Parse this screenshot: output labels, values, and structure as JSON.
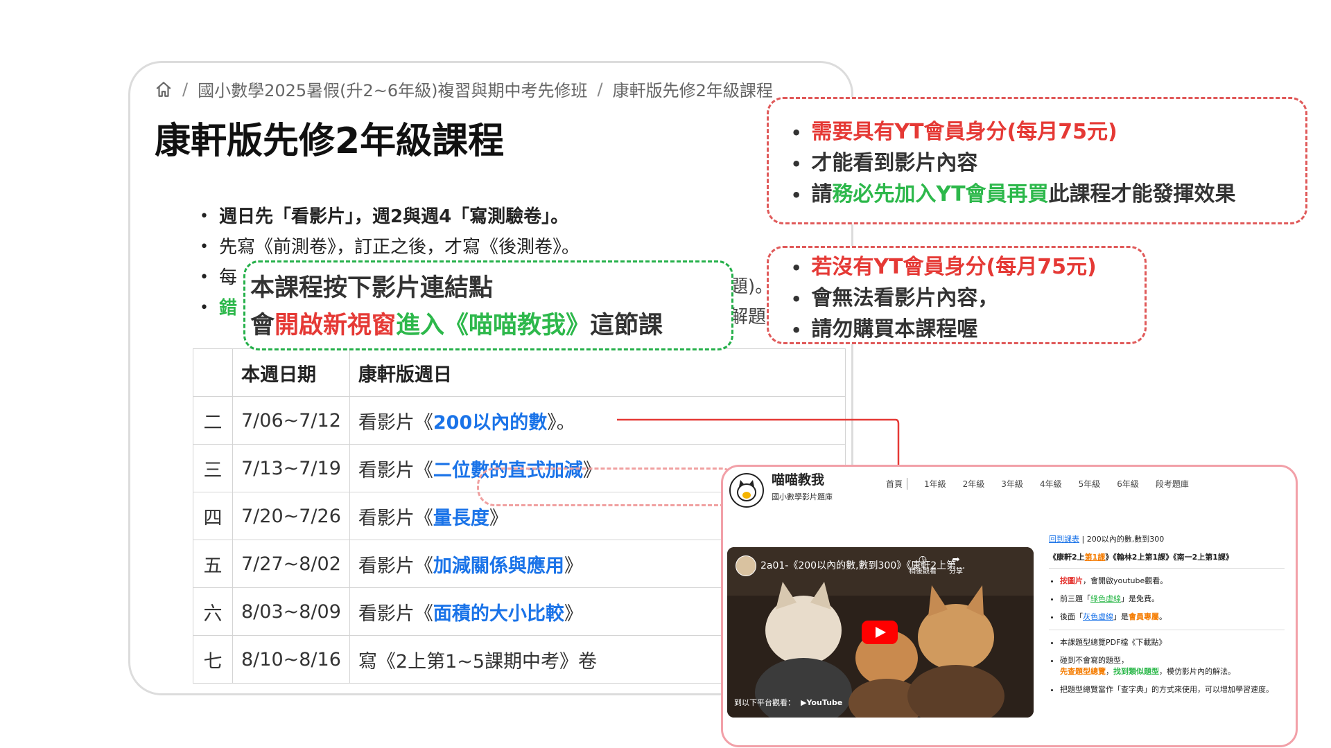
{
  "breadcrumb": {
    "home_icon": "home-icon",
    "items": [
      "國小數學2025暑假(升2~6年級)複習與期中考先修班",
      "康軒版先修2年級課程"
    ]
  },
  "page_title": "康軒版先修2年級課程",
  "bullets": {
    "b1": "週日先「看影片」，週2與週4「寫測驗卷」。",
    "b2": "先寫《前測卷》，訂正之後，才寫《後測卷》。",
    "b3_start": "每",
    "b3_end": "題)。",
    "b4_start": "錯",
    "b4_end": "解題"
  },
  "table": {
    "headers": [
      "",
      "本週日期",
      "康軒版週日"
    ],
    "rows": [
      {
        "week": "二",
        "date": "7/06~7/12",
        "prefix": "看影片《",
        "link": "200以內的數",
        "suffix": "》。"
      },
      {
        "week": "三",
        "date": "7/13~7/19",
        "prefix": "看影片《",
        "link": "二位數的直式加減",
        "suffix": "》"
      },
      {
        "week": "四",
        "date": "7/20~7/26",
        "prefix": "看影片《",
        "link": "量長度",
        "suffix": "》"
      },
      {
        "week": "五",
        "date": "7/27~8/02",
        "prefix": "看影片《",
        "link": "加減關係與應用",
        "suffix": "》"
      },
      {
        "week": "六",
        "date": "8/03~8/09",
        "prefix": "看影片《",
        "link": "面積的大小比較",
        "suffix": "》"
      },
      {
        "week": "七",
        "date": "8/10~8/16",
        "prefix": "寫《2上第1~5課期中考》卷",
        "link": "",
        "suffix": ""
      }
    ]
  },
  "callout_green": {
    "line1": "本課程按下影片連結點",
    "line2_a": "會",
    "line2_b": "開啟新視窗",
    "line2_c": "進入《喵喵教我》",
    "line2_d": "這節課"
  },
  "callout_red1": {
    "l1": "需要具有YT會員身分(每月75元)",
    "l2": "才能看到影片內容",
    "l3_a": "請",
    "l3_b": "務必先加入YT會員再買",
    "l3_c": "此課程才能發揮效果"
  },
  "callout_red2": {
    "l1": "若沒有YT會員身分(每月75元)",
    "l2": "會無法看影片內容，",
    "l3": "請勿購買本課程喔"
  },
  "inset": {
    "site_title": "喵喵教我",
    "site_subtitle": "國小數學影片題庫",
    "nav": [
      "首頁",
      "1年級",
      "2年級",
      "3年級",
      "4年級",
      "5年級",
      "6年級",
      "段考題庫"
    ],
    "video": {
      "title": "2a01-《200以內的數,數到300》《康軒2上第...",
      "watch_later": "稍後觀看",
      "share": "分享",
      "watch_on": "到以下平台觀看：",
      "platform": "YouTube"
    },
    "panel": {
      "back": "回到課表",
      "lesson": "200以內的數,數到300",
      "books_a": "《康軒2上",
      "books_b": "第1課",
      "books_c": "》《翰林2上第1課》《南一2上第1課》",
      "li1_a": "按圖片",
      "li1_b": "，會開啟youtube觀看。",
      "li2_a": "前三題「",
      "li2_b": "綠色虛線",
      "li2_c": "」是免費。",
      "li3_a": "後面「",
      "li3_b": "灰色虛線",
      "li3_c": "」是",
      "li3_d": "會員專屬",
      "li3_e": "。",
      "li4": "本課題型總覽PDF檔《下載點》",
      "li5_a": "碰到不會寫的題型，",
      "li5_b": "先查題型總覽",
      "li5_c": "，",
      "li5_d": "找到類似題型",
      "li5_e": "，模仿影片內的解法。",
      "li6": "把題型總覽當作「查字典」的方式來使用，可以增加學習速度。"
    }
  },
  "colors": {
    "accent_red": "#e53935",
    "accent_green": "#2db84b",
    "link_blue": "#1a73e8",
    "inset_border": "#f2a0a8"
  }
}
